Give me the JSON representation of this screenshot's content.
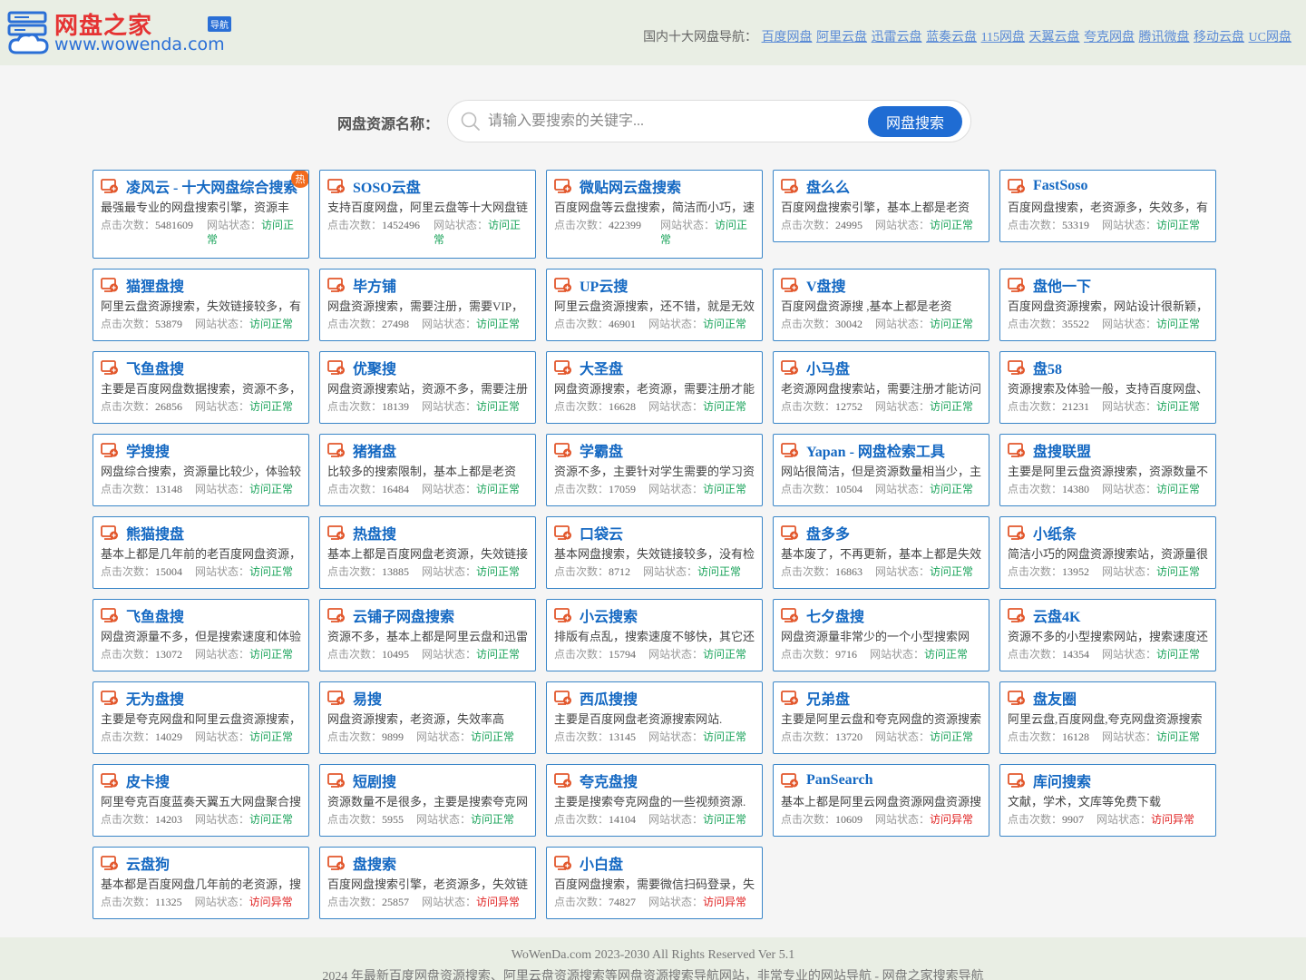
{
  "logo": {
    "title": "网盘之家",
    "badge": "导航",
    "url": "www.wowenda.com"
  },
  "nav": {
    "label": "国内十大网盘导航：",
    "links": [
      "百度网盘",
      "阿里云盘",
      "迅雷云盘",
      "蓝奏云盘",
      "115网盘",
      "天翼云盘",
      "夸克网盘",
      "腾讯微盘",
      "移动云盘",
      "UC网盘"
    ]
  },
  "search": {
    "label": "网盘资源名称：",
    "placeholder": "请输入要搜索的关键字...",
    "button": "网盘搜索"
  },
  "meta_labels": {
    "clicks": "点击次数：",
    "status": "网站状态："
  },
  "status_colors": {
    "ok": "#19a35a",
    "bad": "#e02222",
    "accent": "#1f6cd3"
  },
  "cards": [
    {
      "title": "凌风云 - 十大网盘综合搜索",
      "desc": "最强最专业的网盘搜索引擎，资源丰",
      "clicks": "5481609",
      "status": "访问正常",
      "ok": true,
      "hot": true
    },
    {
      "title": "SOSO云盘",
      "desc": "支持百度网盘，阿里云盘等十大网盘链",
      "clicks": "1452496",
      "status": "访问正常",
      "ok": true
    },
    {
      "title": "微贴网云盘搜索",
      "desc": "百度网盘等云盘搜索，简洁而小巧，速",
      "clicks": "422399",
      "status": "访问正常",
      "ok": true
    },
    {
      "title": "盘么么",
      "desc": "百度网盘搜索引擎，基本上都是老资",
      "clicks": "24995",
      "status": "访问正常",
      "ok": true
    },
    {
      "title": "FastSoso",
      "desc": "百度网盘搜索，老资源多，失效多，有",
      "clicks": "53319",
      "status": "访问正常",
      "ok": true
    },
    {
      "title": "猫狸盘搜",
      "desc": "阿里云盘资源搜索，失效链接较多，有",
      "clicks": "53879",
      "status": "访问正常",
      "ok": true
    },
    {
      "title": "毕方铺",
      "desc": "网盘资源搜索，需要注册，需要VIP，",
      "clicks": "27498",
      "status": "访问正常",
      "ok": true
    },
    {
      "title": "UP云搜",
      "desc": "阿里云盘资源搜索，还不错，就是无效",
      "clicks": "46901",
      "status": "访问正常",
      "ok": true
    },
    {
      "title": "V盘搜",
      "desc": "百度网盘资源搜 ,基本上都是老资",
      "clicks": "30042",
      "status": "访问正常",
      "ok": true
    },
    {
      "title": "盘他一下",
      "desc": "百度网盘资源搜索，网站设计很新颖，",
      "clicks": "35522",
      "status": "访问正常",
      "ok": true
    },
    {
      "title": "飞鱼盘搜",
      "desc": "主要是百度网盘数据搜索，资源不多，",
      "clicks": "26856",
      "status": "访问正常",
      "ok": true
    },
    {
      "title": "优聚搜",
      "desc": "网盘资源搜索站，资源不多，需要注册",
      "clicks": "18139",
      "status": "访问正常",
      "ok": true
    },
    {
      "title": "大圣盘",
      "desc": "网盘资源搜索，老资源，需要注册才能",
      "clicks": "16628",
      "status": "访问正常",
      "ok": true
    },
    {
      "title": "小马盘",
      "desc": "老资源网盘搜索站，需要注册才能访问",
      "clicks": "12752",
      "status": "访问正常",
      "ok": true
    },
    {
      "title": "盘58",
      "desc": "资源搜索及体验一般，支持百度网盘、",
      "clicks": "21231",
      "status": "访问正常",
      "ok": true
    },
    {
      "title": "学搜搜",
      "desc": "网盘综合搜索，资源量比较少，体验较",
      "clicks": "13148",
      "status": "访问正常",
      "ok": true
    },
    {
      "title": "猪猪盘",
      "desc": "比较多的搜索限制，基本上都是老资",
      "clicks": "16484",
      "status": "访问正常",
      "ok": true
    },
    {
      "title": "学霸盘",
      "desc": "资源不多，主要针对学生需要的学习资",
      "clicks": "17059",
      "status": "访问正常",
      "ok": true
    },
    {
      "title": "Yapan - 网盘检索工具",
      "desc": "网站很简洁，但是资源数量相当少，主",
      "clicks": "10504",
      "status": "访问正常",
      "ok": true
    },
    {
      "title": "盘搜联盟",
      "desc": "主要是阿里云盘资源搜索，资源数量不",
      "clicks": "14380",
      "status": "访问正常",
      "ok": true
    },
    {
      "title": "熊猫搜盘",
      "desc": "基本上都是几年前的老百度网盘资源，",
      "clicks": "15004",
      "status": "访问正常",
      "ok": true
    },
    {
      "title": "热盘搜",
      "desc": "基本上都是百度网盘老资源，失效链接",
      "clicks": "13885",
      "status": "访问正常",
      "ok": true
    },
    {
      "title": "口袋云",
      "desc": "基本网盘搜索，失效链接较多，没有检",
      "clicks": "8712",
      "status": "访问正常",
      "ok": true
    },
    {
      "title": "盘多多",
      "desc": "基本废了，不再更新，基本上都是失效",
      "clicks": "16863",
      "status": "访问正常",
      "ok": true
    },
    {
      "title": "小纸条",
      "desc": "简洁小巧的网盘资源搜索站，资源量很",
      "clicks": "13952",
      "status": "访问正常",
      "ok": true
    },
    {
      "title": "飞鱼盘搜",
      "desc": "网盘资源量不多，但是搜索速度和体验",
      "clicks": "13072",
      "status": "访问正常",
      "ok": true
    },
    {
      "title": "云铺子网盘搜索",
      "desc": "资源不多，基本上都是阿里云盘和迅雷",
      "clicks": "10495",
      "status": "访问正常",
      "ok": true
    },
    {
      "title": "小云搜索",
      "desc": "排版有点乱，搜索速度不够快，其它还",
      "clicks": "15794",
      "status": "访问正常",
      "ok": true
    },
    {
      "title": "七夕盘搜",
      "desc": "网盘资源量非常少的一个小型搜索网",
      "clicks": "9716",
      "status": "访问正常",
      "ok": true
    },
    {
      "title": "云盘4K",
      "desc": "资源不多的小型搜索网站，搜索速度还",
      "clicks": "14354",
      "status": "访问正常",
      "ok": true
    },
    {
      "title": "无为盘搜",
      "desc": "主要是夸克网盘和阿里云盘资源搜索，",
      "clicks": "14029",
      "status": "访问正常",
      "ok": true
    },
    {
      "title": "易搜",
      "desc": "网盘资源搜索，老资源，失效率高",
      "clicks": "9899",
      "status": "访问正常",
      "ok": true
    },
    {
      "title": "西瓜搜搜",
      "desc": "主要是百度网盘老资源搜索网站.",
      "clicks": "13145",
      "status": "访问正常",
      "ok": true
    },
    {
      "title": "兄弟盘",
      "desc": "主要是阿里云盘和夸克网盘的资源搜索",
      "clicks": "13720",
      "status": "访问正常",
      "ok": true
    },
    {
      "title": "盘友圈",
      "desc": "阿里云盘,百度网盘,夸克网盘资源搜索",
      "clicks": "16128",
      "status": "访问正常",
      "ok": true
    },
    {
      "title": "皮卡搜",
      "desc": "阿里夸克百度蓝奏天翼五大网盘聚合搜",
      "clicks": "14203",
      "status": "访问正常",
      "ok": true
    },
    {
      "title": "短剧搜",
      "desc": "资源数量不是很多，主要是搜索夸克网",
      "clicks": "5955",
      "status": "访问正常",
      "ok": true
    },
    {
      "title": "夸克盘搜",
      "desc": "主要是搜索夸克网盘的一些视频资源.",
      "clicks": "14104",
      "status": "访问正常",
      "ok": true
    },
    {
      "title": "PanSearch",
      "desc": "基本上都是阿里云网盘资源网盘资源搜",
      "clicks": "10609",
      "status": "访问异常",
      "ok": false
    },
    {
      "title": "库问搜索",
      "desc": "文献，学术，文库等免费下载",
      "clicks": "9907",
      "status": "访问异常",
      "ok": false
    },
    {
      "title": "云盘狗",
      "desc": "基本都是百度网盘几年前的老资源，搜",
      "clicks": "11325",
      "status": "访问异常",
      "ok": false
    },
    {
      "title": "盘搜索",
      "desc": "百度网盘搜索引擎，老资源多，失效链",
      "clicks": "25857",
      "status": "访问异常",
      "ok": false
    },
    {
      "title": "小白盘",
      "desc": "百度网盘搜索，需要微信扫码登录，失",
      "clicks": "74827",
      "status": "访问异常",
      "ok": false
    }
  ],
  "footer": {
    "line1": "WoWenDa.com 2023-2030 All Rights Reserved Ver 5.1",
    "line2": "2024 年最新百度网盘资源搜索、阿里云盘资源搜索等网盘资源搜索导航网站，非常专业的网站导航 - 网盘之家搜索导航"
  }
}
